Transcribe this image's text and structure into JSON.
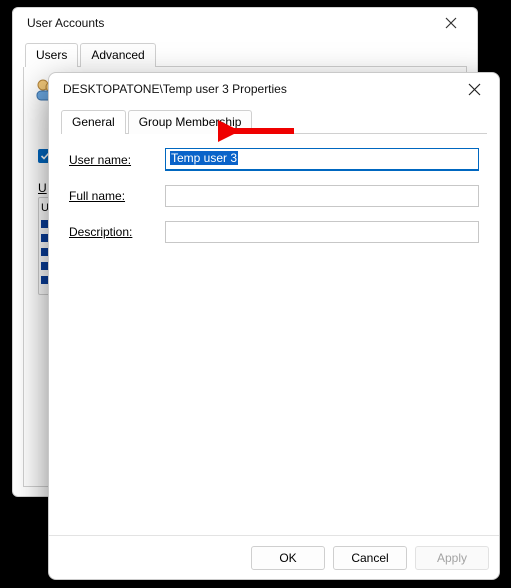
{
  "parent": {
    "title": "User Accounts",
    "tabs": [
      "Users",
      "Advanced"
    ],
    "users_label_first_letter": "U",
    "checkbox_checked": true,
    "header_first_letter": "U"
  },
  "modal": {
    "title": "DESKTOPATONE\\Temp user 3 Properties",
    "tabs": {
      "general": "General",
      "group_membership": "Group Membership"
    },
    "active_tab": "general",
    "fields": {
      "user_name": {
        "label": "User name:",
        "value": "Temp user 3"
      },
      "full_name": {
        "label": "Full name:",
        "value": ""
      },
      "description": {
        "label": "Description:",
        "value": ""
      }
    },
    "buttons": {
      "ok": "OK",
      "cancel": "Cancel",
      "apply": "Apply"
    },
    "apply_enabled": false
  }
}
